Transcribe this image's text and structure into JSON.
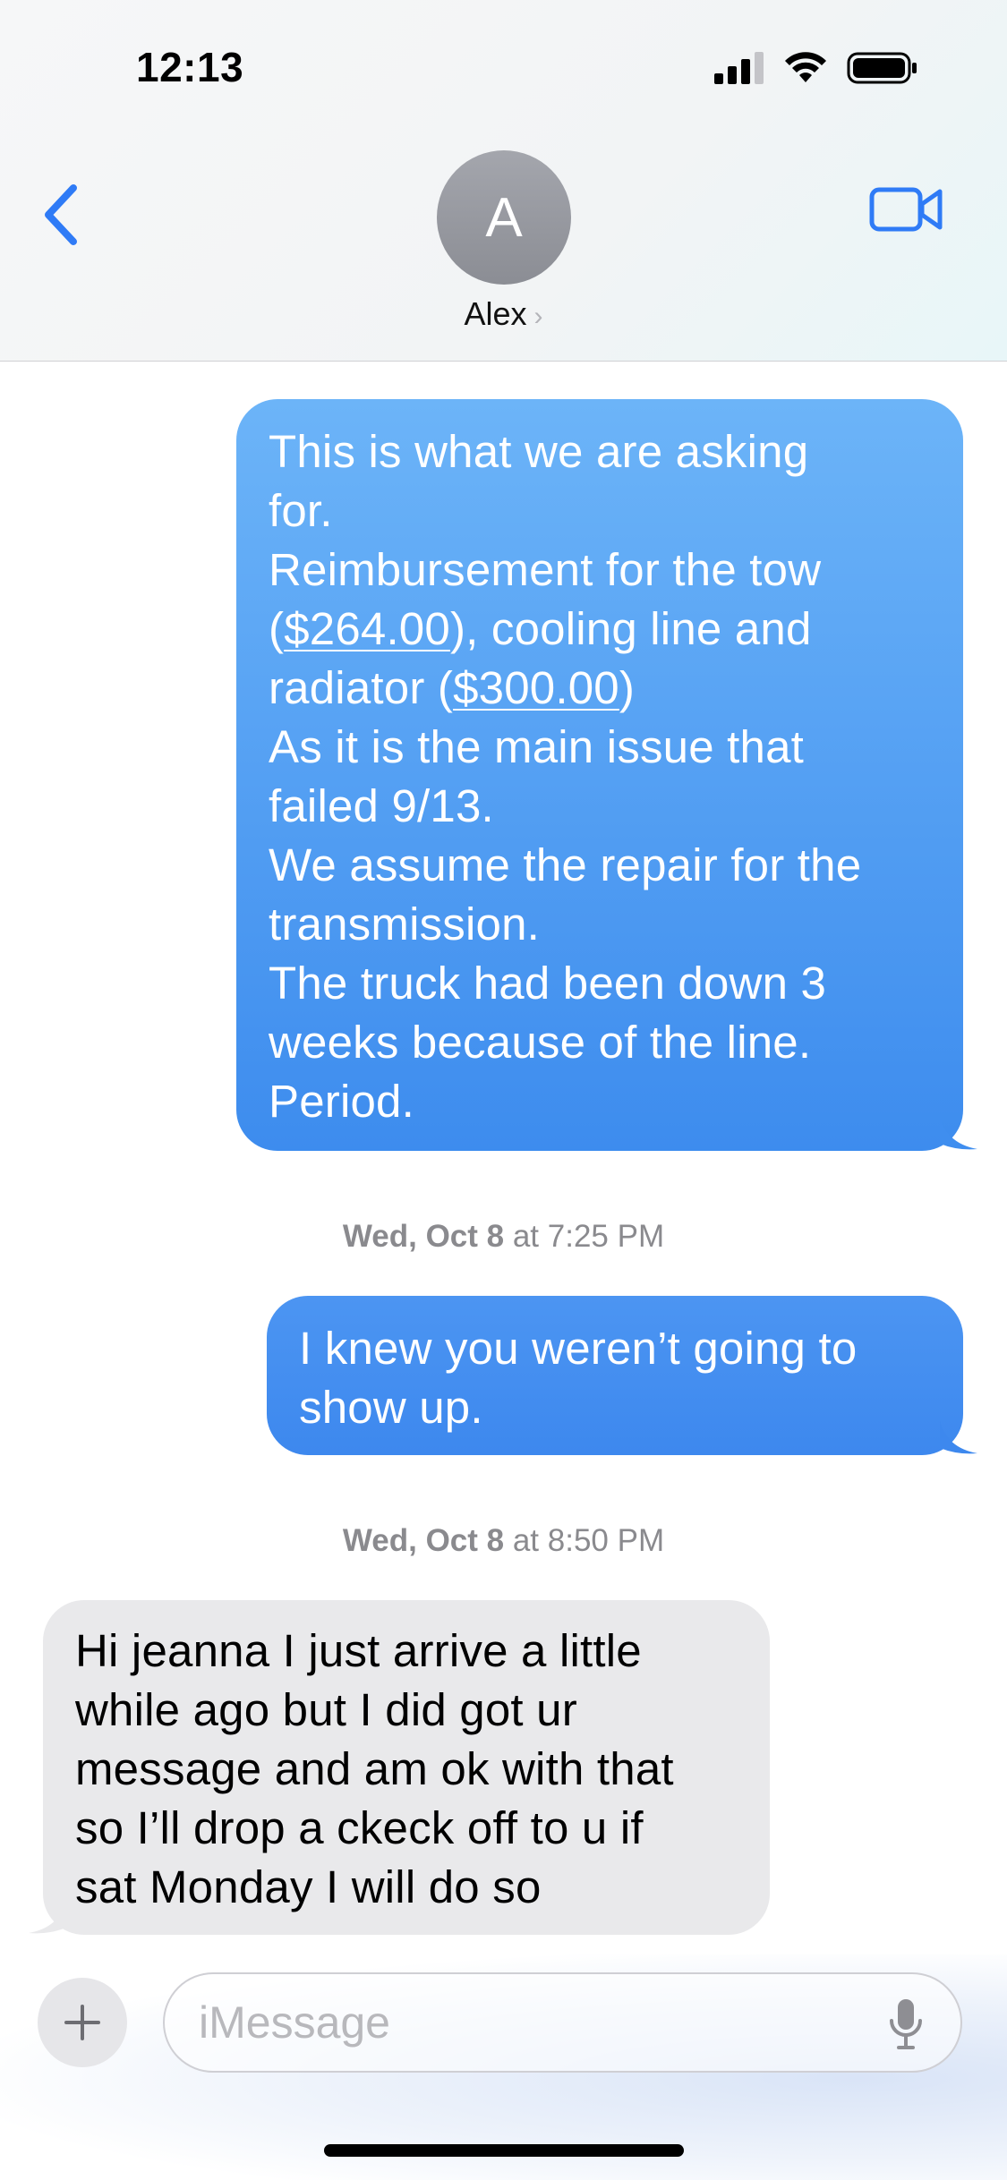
{
  "status_bar": {
    "time": "12:13"
  },
  "header": {
    "avatar_initial": "A",
    "contact_name": "Alex"
  },
  "messages": [
    {
      "direction": "outgoing",
      "lines": [
        "This is what we are asking",
        "for.",
        "Reimbursement for the tow",
        "($264.00), cooling line and",
        "radiator ($300.00)",
        "As it is the main issue that",
        "failed 9/13.",
        "We assume the repair for the",
        "transmission.",
        "The truck had been down 3",
        "weeks because of the line.",
        "Period."
      ],
      "links": [
        "$264.00",
        "$300.00"
      ]
    },
    {
      "timestamp_day": "Wed, Oct 8",
      "timestamp_time": "at 7:25 PM",
      "direction": "outgoing",
      "lines": [
        "I knew you weren’t going to",
        "show up."
      ]
    },
    {
      "timestamp_day": "Wed, Oct 8",
      "timestamp_time": "at 8:50 PM",
      "direction": "incoming",
      "lines": [
        "Hi jeanna I just arrive a little",
        "while ago but I did got ur",
        "message and am ok with that",
        "so I’ll drop a ckeck off to u if",
        "sat Monday I will do so"
      ]
    }
  ],
  "compose": {
    "placeholder": "iMessage"
  },
  "colors": {
    "accent": "#2f7bf6",
    "outgoing_bubble": "#3d8cee",
    "incoming_bubble": "#e9e9eb"
  },
  "icons": [
    "back-chevron-icon",
    "video-camera-icon",
    "plus-icon",
    "microphone-icon",
    "signal-icon",
    "wifi-icon",
    "battery-icon"
  ]
}
